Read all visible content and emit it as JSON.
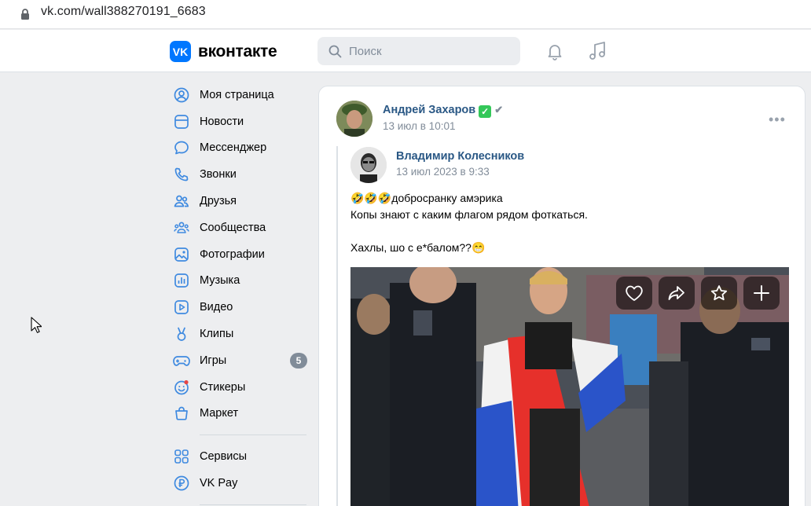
{
  "browser": {
    "url": "vk.com/wall388270191_6683"
  },
  "header": {
    "logo_text": "вконтакте",
    "logo_mark": "VK",
    "search_placeholder": "Поиск"
  },
  "sidebar": {
    "items": [
      {
        "label": "Моя страница",
        "icon": "profile-icon"
      },
      {
        "label": "Новости",
        "icon": "news-icon"
      },
      {
        "label": "Мессенджер",
        "icon": "messenger-icon"
      },
      {
        "label": "Звонки",
        "icon": "phone-icon"
      },
      {
        "label": "Друзья",
        "icon": "friends-icon"
      },
      {
        "label": "Сообщества",
        "icon": "communities-icon"
      },
      {
        "label": "Фотографии",
        "icon": "photos-icon"
      },
      {
        "label": "Музыка",
        "icon": "music-icon"
      },
      {
        "label": "Видео",
        "icon": "video-icon"
      },
      {
        "label": "Клипы",
        "icon": "clips-icon"
      },
      {
        "label": "Игры",
        "icon": "games-icon",
        "badge": "5"
      },
      {
        "label": "Стикеры",
        "icon": "stickers-icon"
      },
      {
        "label": "Маркет",
        "icon": "market-icon"
      }
    ],
    "secondary_items": [
      {
        "label": "Сервисы",
        "icon": "services-icon"
      },
      {
        "label": "VK Pay",
        "icon": "vkpay-icon"
      }
    ]
  },
  "post": {
    "author": "Андрей Захаров",
    "author_badge": "✅",
    "date": "13 июл в 10:01",
    "more": "•••",
    "repost": {
      "author": "Владимир Колесников",
      "date": "13 июл 2023 в 9:33",
      "text_lines": [
        "🤣🤣🤣добросранку амэрика",
        "Копы знают с каким флагом рядом фоткаться.",
        "",
        "Хахлы, шо с е*балом??😁"
      ]
    },
    "media_actions": [
      "like-icon",
      "share-icon",
      "favorite-icon",
      "add-icon"
    ]
  },
  "colors": {
    "accent": "#0077ff",
    "link": "#2a5885",
    "muted": "#818c99",
    "icon": "#3f8ae0"
  }
}
